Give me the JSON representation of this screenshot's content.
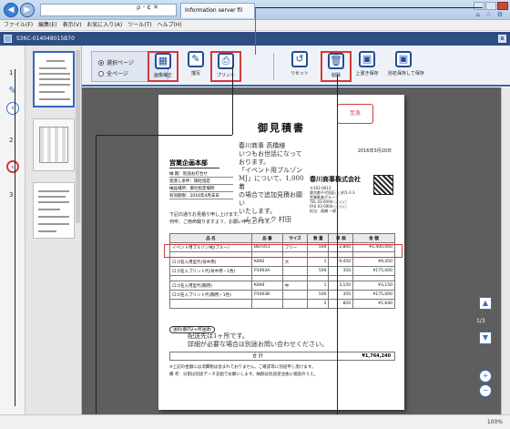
{
  "browser": {
    "tab_title": "Information server fil",
    "address_controls": "ρ - ¢ ✕",
    "menu": [
      "ファイル(F)",
      "編集(E)",
      "表示(V)",
      "お気に入り(A)",
      "ツール(T)",
      "ヘルプ(H)"
    ],
    "home_icons": "⌂ ☆ ⚙"
  },
  "app": {
    "title": "S36C-014048015B70",
    "close": "x"
  },
  "thumbnails": {
    "page_numbers": [
      "1",
      "2",
      "3"
    ],
    "pen_icon": "✎",
    "collapse_icon": "‹"
  },
  "toolbar": {
    "page_options": [
      "選択ページ",
      "全ページ"
    ],
    "buttons": {
      "image_correct": "画像補正",
      "annotate": "描写",
      "print": "プリント",
      "reset": "リセット",
      "delete": "削除",
      "save_overwrite": "上書き保存",
      "save_as": "別名保存して保存"
    }
  },
  "page_nav": {
    "count": "1/3",
    "up": "▲",
    "down": "▼",
    "zoom_in": "+",
    "zoom_out": "−"
  },
  "document": {
    "stamp": "至急",
    "title": "御見積書",
    "date": "2016年3月20日",
    "customer": "営業企画本部",
    "info_rows": [
      "納 期：別途お打合せ",
      "受渡し条件：御社指定",
      "納品場所：御社指定場所",
      "有効期限：2016年4月末日"
    ],
    "memo_lines": [
      "春川商事 高橋様",
      "いつもお世話になって",
      "おります。",
      "「イベント用ブルゾン",
      "MJ」について、1,000着",
      "の場合で追加見積お願い",
      "いたします。",
      "　ムラテック 村田"
    ],
    "company_name": "春川商事株式会社",
    "company_lines": [
      "〒102-0013",
      "東京都千代田区○○町1-2-3",
      "営業推進グループ",
      "TEL 03-0000-○○○○",
      "FAX 03-0000-○○○○",
      "担当：高橋 一郎"
    ],
    "intro_lines": [
      "下記の通りお見積り申し上げます。",
      "何卒、ご用命賜りますよう、お願い申し上げます。"
    ],
    "table_headers": [
      "品 名",
      "品 番",
      "サイズ",
      "数 量",
      "単 価",
      "金 額"
    ],
    "rows": [
      [
        "イベント用ブルゾンMJ(ブルー)",
        "BB7051",
        "フリー",
        "500",
        "2,800",
        "¥1,400,000"
      ],
      [
        "ロゴ名入用型代(背中用)",
        "K892",
        "大",
        "1",
        "9,450",
        "¥9,450"
      ],
      [
        "ロゴ名入プリント代(背中用・1色)",
        "P1003A",
        "",
        "500",
        "350",
        "¥175,000"
      ],
      [
        "ロゴ名入用型代(胸用)",
        "K894",
        "中",
        "1",
        "3,150",
        "¥3,150"
      ],
      [
        "ロゴ名入プリント代(胸用・1色)",
        "P1003B",
        "",
        "500",
        "350",
        "¥175,000"
      ],
      [
        "",
        "",
        "",
        "2",
        "820",
        "¥1,640"
      ]
    ],
    "note_label": "送料(都内2ヶ所送達)",
    "note_hand": [
      "配送先は1ヶ所です。",
      "詳細が必要な場合は別途お問い合わせください。"
    ],
    "total_label": "合 計",
    "total_value": "¥1,764,240",
    "footnotes": [
      "※上記の金額には消費税は含まれておりません。ご確認等に別途申し受けます。",
      "備 考：分割は別途データ支給でお願いします。納期は別途受注後に相談のうえ。"
    ]
  },
  "status": {
    "zoom": "100%"
  }
}
